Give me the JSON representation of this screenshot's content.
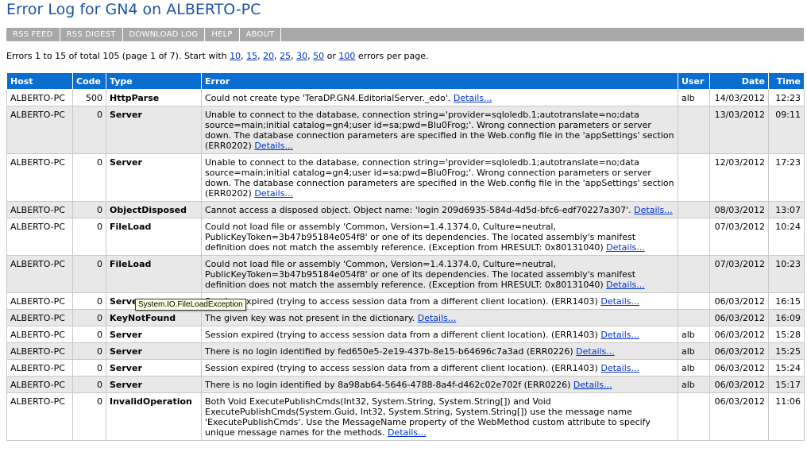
{
  "title": "Error Log for GN4 on ALBERTO-PC",
  "menu": [
    "RSS FEED",
    "RSS DIGEST",
    "DOWNLOAD LOG",
    "HELP",
    "ABOUT"
  ],
  "summary": {
    "prefix": "Errors 1 to 15 of total 105 (page 1 of 7). Start with ",
    "page_sizes": [
      "10",
      "15",
      "20",
      "25",
      "30",
      "50",
      "100"
    ],
    "suffix": " errors per page."
  },
  "columns": {
    "host": "Host",
    "code": "Code",
    "type": "Type",
    "error": "Error",
    "user": "User",
    "date": "Date",
    "time": "Time"
  },
  "details_label": "Details...",
  "rows": [
    {
      "host": "ALBERTO-PC",
      "code": "500",
      "type": "HttpParse",
      "error": "Could not create type 'TeraDP.GN4.EditorialServer._edo'.",
      "user": "alb",
      "date": "14/03/2012",
      "time": "12:23"
    },
    {
      "host": "ALBERTO-PC",
      "code": "0",
      "type": "Server",
      "error": "Unable to connect to the database, connection string='provider=sqloledb.1;autotranslate=no;data source=main;initial catalog=gn4;user id=sa;pwd=Blu0Frog;'. Wrong connection parameters or server down. The database connection parameters are specified in the Web.config file in the 'appSettings' section (ERR0202)",
      "user": "",
      "date": "13/03/2012",
      "time": "09:11"
    },
    {
      "host": "ALBERTO-PC",
      "code": "0",
      "type": "Server",
      "error": "Unable to connect to the database, connection string='provider=sqloledb.1;autotranslate=no;data source=main;initial catalog=gn4;user id=sa;pwd=Blu0Frog;'. Wrong connection parameters or server down. The database connection parameters are specified in the Web.config file in the 'appSettings' section (ERR0202)",
      "user": "",
      "date": "12/03/2012",
      "time": "17:23"
    },
    {
      "host": "ALBERTO-PC",
      "code": "0",
      "type": "ObjectDisposed",
      "error": "Cannot access a disposed object. Object name: 'login 209d6935-584d-4d5d-bfc6-edf70227a307'.",
      "user": "",
      "date": "08/03/2012",
      "time": "13:07"
    },
    {
      "host": "ALBERTO-PC",
      "code": "0",
      "type": "FileLoad",
      "error": "Could not load file or assembly 'Common, Version=1.4.1374.0, Culture=neutral, PublicKeyToken=3b47b95184e054f8' or one of its dependencies. The located assembly's manifest definition does not match the assembly reference. (Exception from HRESULT: 0x80131040)",
      "user": "",
      "date": "07/03/2012",
      "time": "10:24"
    },
    {
      "host": "ALBERTO-PC",
      "code": "0",
      "type": "FileLoad",
      "error": "Could not load file or assembly 'Common, Version=1.4.1374.0, Culture=neutral, PublicKeyToken=3b47b95184e054f8' or one of its dependencies. The located assembly's manifest definition does not match the assembly reference. (Exception from HRESULT: 0x80131040)",
      "user": "",
      "date": "07/03/2012",
      "time": "10:23"
    },
    {
      "host": "ALBERTO-PC",
      "code": "0",
      "type": "Server",
      "error": "Session expired (trying to access session data from a different client location). (ERR1403)",
      "user": "",
      "date": "06/03/2012",
      "time": "16:15"
    },
    {
      "host": "ALBERTO-PC",
      "code": "0",
      "type": "KeyNotFound",
      "error": "The given key was not present in the dictionary.",
      "user": "",
      "date": "06/03/2012",
      "time": "16:09"
    },
    {
      "host": "ALBERTO-PC",
      "code": "0",
      "type": "Server",
      "error": "Session expired (trying to access session data from a different client location). (ERR1403)",
      "user": "alb",
      "date": "06/03/2012",
      "time": "15:28"
    },
    {
      "host": "ALBERTO-PC",
      "code": "0",
      "type": "Server",
      "error": "There is no login identified by fed650e5-2e19-437b-8e15-b64696c7a3ad (ERR0226)",
      "user": "alb",
      "date": "06/03/2012",
      "time": "15:25"
    },
    {
      "host": "ALBERTO-PC",
      "code": "0",
      "type": "Server",
      "error": "Session expired (trying to access session data from a different client location). (ERR1403)",
      "user": "alb",
      "date": "06/03/2012",
      "time": "15:24"
    },
    {
      "host": "ALBERTO-PC",
      "code": "0",
      "type": "Server",
      "error": "There is no login identified by 8a98ab64-5646-4788-8a4f-d462c02e702f (ERR0226)",
      "user": "alb",
      "date": "06/03/2012",
      "time": "15:17"
    },
    {
      "host": "ALBERTO-PC",
      "code": "0",
      "type": "InvalidOperation",
      "error": "Both Void ExecutePublishCmds(Int32, System.String, System.String[]) and Void ExecutePublishCmds(System.Guid, Int32, System.String, System.String[]) use the message name 'ExecutePublishCmds'. Use the MessageName property of the WebMethod custom attribute to specify unique message names for the methods.",
      "user": "",
      "date": "06/03/2012",
      "time": "11:06"
    }
  ],
  "tooltip": "System.IO.FileLoadException"
}
